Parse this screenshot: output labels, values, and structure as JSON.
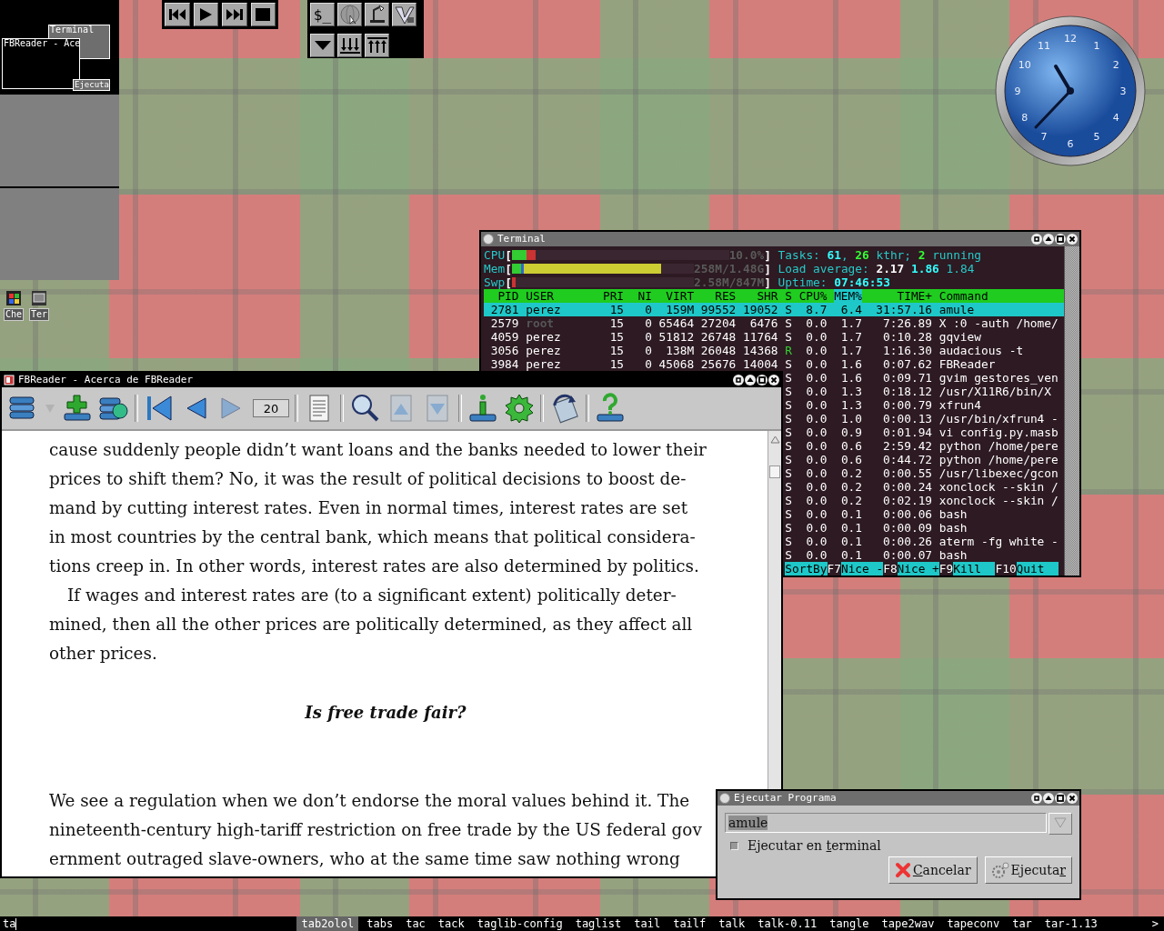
{
  "pager": {
    "windows": [
      {
        "title": "Terminal"
      },
      {
        "title": "FBReader - Ace"
      },
      {
        "title": "Ejecuta"
      }
    ]
  },
  "media_toolbar": {
    "buttons": [
      {
        "kind": "previous"
      },
      {
        "kind": "play"
      },
      {
        "kind": "next"
      },
      {
        "kind": "stop"
      }
    ]
  },
  "launcher": {
    "buttons": [
      {
        "kind": "text",
        "label": "$_"
      },
      {
        "kind": "globe"
      },
      {
        "kind": "desk"
      },
      {
        "kind": "editor"
      },
      {
        "kind": "menu"
      },
      {
        "kind": "lower"
      },
      {
        "kind": "raise"
      }
    ]
  },
  "clock": {
    "numerals": [
      "12",
      "1",
      "2",
      "3",
      "4",
      "5",
      "6",
      "7",
      "8",
      "9",
      "10",
      "11"
    ]
  },
  "desktop_icons": [
    {
      "label": "Che",
      "kind": "app"
    },
    {
      "label": "Ter",
      "kind": "terminal"
    }
  ],
  "terminal": {
    "title": "Terminal",
    "meters": [
      {
        "label": "CPU",
        "open": "[",
        "level": 0.11,
        "value": "10.0%",
        "close": "]",
        "kind": "cpu"
      },
      {
        "label": "Mem",
        "open": "[",
        "level": 0.82,
        "value": "258M/1.48G",
        "close": "]",
        "kind": "mem"
      },
      {
        "label": "Swp",
        "open": "[",
        "level": 0.02,
        "value": "2.58M/847M",
        "close": "]",
        "kind": "swap"
      }
    ],
    "summary": [
      [
        {
          "text": "Tasks: ",
          "kind": "label"
        },
        {
          "text": "61",
          "kind": "value"
        },
        {
          "text": ", ",
          "kind": "label"
        },
        {
          "text": "26",
          "kind": "green"
        },
        {
          "text": " kthr; ",
          "kind": "label"
        },
        {
          "text": "2",
          "kind": "green"
        },
        {
          "text": " running",
          "kind": "label"
        }
      ],
      [
        {
          "text": "Load average: ",
          "kind": "label"
        },
        {
          "text": "2.17",
          "kind": "white"
        },
        {
          "text": " 1.86",
          "kind": "value"
        },
        {
          "text": " 1.84",
          "kind": "label"
        }
      ],
      [
        {
          "text": "Uptime: ",
          "kind": "label"
        },
        {
          "text": "07:46:53",
          "kind": "value"
        }
      ]
    ],
    "columns": [
      {
        "label": "PID",
        "selected": false
      },
      {
        "label": "USER",
        "selected": false
      },
      {
        "label": "PRI",
        "selected": false
      },
      {
        "label": "NI",
        "selected": false
      },
      {
        "label": "VIRT",
        "selected": false
      },
      {
        "label": "RES",
        "selected": false
      },
      {
        "label": "SHR",
        "selected": false
      },
      {
        "label": "S",
        "selected": false
      },
      {
        "label": "CPU%",
        "selected": false
      },
      {
        "label": "MEM%",
        "selected": true
      },
      {
        "label": "TIME+",
        "selected": false
      },
      {
        "label": "Command",
        "selected": false
      }
    ],
    "processes": [
      {
        "pid": "2781",
        "user": "perez",
        "pri": "15",
        "ni": "0",
        "virt": "159M",
        "res": "99552",
        "shr": "19052",
        "state": "S",
        "cpu": "8.7",
        "mem": "6.4",
        "time": "31:57.16",
        "command": "amule",
        "selected": true,
        "user_dimmed": false,
        "running": false
      },
      {
        "pid": "2579",
        "user": "root",
        "pri": "15",
        "ni": "0",
        "virt": "65464",
        "res": "27204",
        "shr": "6476",
        "state": "S",
        "cpu": "0.0",
        "mem": "1.7",
        "time": "7:26.89",
        "command": "X :0 -auth /home/",
        "selected": false,
        "user_dimmed": true,
        "running": false
      },
      {
        "pid": "4059",
        "user": "perez",
        "pri": "15",
        "ni": "0",
        "virt": "51812",
        "res": "26748",
        "shr": "11764",
        "state": "S",
        "cpu": "0.0",
        "mem": "1.7",
        "time": "0:10.28",
        "command": "gqview",
        "selected": false,
        "user_dimmed": false,
        "running": false
      },
      {
        "pid": "3056",
        "user": "perez",
        "pri": "15",
        "ni": "0",
        "virt": "138M",
        "res": "26048",
        "shr": "14368",
        "state": "R",
        "cpu": "0.0",
        "mem": "1.7",
        "time": "1:16.30",
        "command": "audacious -t",
        "selected": false,
        "user_dimmed": false,
        "running": true
      },
      {
        "pid": "3984",
        "user": "perez",
        "pri": "15",
        "ni": "0",
        "virt": "45068",
        "res": "25676",
        "shr": "14004",
        "state": "S",
        "cpu": "0.0",
        "mem": "1.6",
        "time": "0:07.62",
        "command": "FBReader",
        "selected": false,
        "user_dimmed": false,
        "running": false
      },
      {
        "state": "S",
        "cpu": "0.0",
        "mem": "1.6",
        "time": "0:09.71",
        "command": "gvim gestores_ven",
        "selected": false,
        "running": false
      },
      {
        "state": "S",
        "cpu": "0.0",
        "mem": "1.3",
        "time": "0:18.12",
        "command": "/usr/X11R6/bin/X",
        "selected": false,
        "running": false
      },
      {
        "state": "S",
        "cpu": "0.0",
        "mem": "1.3",
        "time": "0:00.79",
        "command": "xfrun4",
        "selected": false,
        "running": false
      },
      {
        "state": "S",
        "cpu": "0.0",
        "mem": "1.0",
        "time": "0:00.13",
        "command": "/usr/bin/xfrun4 -",
        "selected": false,
        "running": false
      },
      {
        "state": "S",
        "cpu": "0.0",
        "mem": "0.9",
        "time": "0:01.94",
        "command": "vi config.py.masb",
        "selected": false,
        "running": false
      },
      {
        "state": "S",
        "cpu": "0.0",
        "mem": "0.6",
        "time": "2:59.42",
        "command": "python /home/pere",
        "selected": false,
        "running": false
      },
      {
        "state": "S",
        "cpu": "0.0",
        "mem": "0.6",
        "time": "0:44.72",
        "command": "python /home/pere",
        "selected": false,
        "running": false
      },
      {
        "state": "S",
        "cpu": "0.0",
        "mem": "0.2",
        "time": "0:00.55",
        "command": "/usr/libexec/gcon",
        "selected": false,
        "running": false
      },
      {
        "state": "S",
        "cpu": "0.0",
        "mem": "0.2",
        "time": "0:00.24",
        "command": "xonclock --skin /",
        "selected": false,
        "running": false
      },
      {
        "state": "S",
        "cpu": "0.0",
        "mem": "0.2",
        "time": "0:02.19",
        "command": "xonclock --skin /",
        "selected": false,
        "running": false
      },
      {
        "state": "S",
        "cpu": "0.0",
        "mem": "0.1",
        "time": "0:00.06",
        "command": "bash",
        "selected": false,
        "running": false
      },
      {
        "state": "S",
        "cpu": "0.0",
        "mem": "0.1",
        "time": "0:00.09",
        "command": "bash",
        "selected": false,
        "running": false
      },
      {
        "state": "S",
        "cpu": "0.0",
        "mem": "0.1",
        "time": "0:00.26",
        "command": "aterm -fg white -",
        "selected": false,
        "running": false
      },
      {
        "state": "S",
        "cpu": "0.0",
        "mem": "0.1",
        "time": "0:00.07",
        "command": "bash",
        "selected": false,
        "running": false
      }
    ],
    "function_keys": [
      {
        "label": "SortBy"
      },
      {
        "key": "F7",
        "label": "Nice -"
      },
      {
        "key": "F8",
        "label": "Nice +"
      },
      {
        "key": "F9",
        "label": "Kill"
      },
      {
        "key": "F10",
        "label": "Quit"
      }
    ]
  },
  "reader": {
    "title": "FBReader - Acerca de FBReader",
    "toolbar": [
      {
        "kind": "books",
        "disabled": false
      },
      {
        "kind": "dropdown",
        "disabled": true
      },
      {
        "kind": "add-book",
        "disabled": false
      },
      {
        "kind": "book-globe",
        "disabled": false
      },
      {
        "kind": "separator"
      },
      {
        "kind": "first-page",
        "disabled": false
      },
      {
        "kind": "back",
        "disabled": false
      },
      {
        "kind": "forward",
        "disabled": true
      },
      {
        "kind": "page-field",
        "value": "20"
      },
      {
        "kind": "separator"
      },
      {
        "kind": "document",
        "disabled": false
      },
      {
        "kind": "separator"
      },
      {
        "kind": "search",
        "disabled": false
      },
      {
        "kind": "page-up",
        "disabled": true
      },
      {
        "kind": "page-down",
        "disabled": true
      },
      {
        "kind": "separator"
      },
      {
        "kind": "info",
        "disabled": false
      },
      {
        "kind": "settings",
        "disabled": false
      },
      {
        "kind": "separator"
      },
      {
        "kind": "rotate",
        "disabled": false
      },
      {
        "kind": "separator"
      },
      {
        "kind": "help",
        "disabled": false
      }
    ],
    "paragraphs": [
      {
        "kind": "body",
        "indent": false,
        "lines": [
          "cause suddenly people didn’t want loans and the banks needed to lower their",
          "prices to shift them? No, it was the result of political decisions to boost de-",
          "mand by cutting interest rates. Even in normal times, interest rates are set",
          "in most countries by the central bank, which means that political considera-",
          "tions creep in. In other words, interest rates are also determined by politics."
        ]
      },
      {
        "kind": "body",
        "indent": true,
        "lines": [
          "If wages and interest rates are (to a significant extent) politically deter-",
          "mined, then all the other prices are politically determined, as they affect all",
          "other prices."
        ]
      },
      {
        "kind": "heading",
        "text": "Is free trade fair?"
      },
      {
        "kind": "body",
        "indent": false,
        "lines": [
          "We see a regulation when we don’t endorse the moral values behind it. The",
          "nineteenth-century high-tariff restriction on free trade by the US federal gov",
          "ernment outraged slave-owners, who at the same time saw nothing wrong"
        ]
      }
    ]
  },
  "run_dialog": {
    "title": "Ejecutar Programa",
    "command": {
      "value": "amule",
      "text_selected": true
    },
    "terminal_option": {
      "before": "Ejecutar en ",
      "key": "t",
      "after": "erminal",
      "checked": false
    },
    "buttons": [
      {
        "kind": "cancel",
        "key": "C",
        "after": "ancelar"
      },
      {
        "kind": "run",
        "before": "Ejecuta",
        "key": "r"
      }
    ]
  },
  "completion_bar": {
    "input": "ta",
    "items": [
      {
        "label": "tab2olol",
        "selected": true
      },
      {
        "label": "tabs",
        "selected": false
      },
      {
        "label": "tac",
        "selected": false
      },
      {
        "label": "tack",
        "selected": false
      },
      {
        "label": "taglib-config",
        "selected": false
      },
      {
        "label": "taglist",
        "selected": false
      },
      {
        "label": "tail",
        "selected": false
      },
      {
        "label": "tailf",
        "selected": false
      },
      {
        "label": "talk",
        "selected": false
      },
      {
        "label": "talk-0.11",
        "selected": false
      },
      {
        "label": "tangle",
        "selected": false
      },
      {
        "label": "tape2wav",
        "selected": false
      },
      {
        "label": "tapeconv",
        "selected": false
      },
      {
        "label": "tar",
        "selected": false
      },
      {
        "label": "tar-1.13",
        "selected": false
      }
    ],
    "more": ">"
  }
}
